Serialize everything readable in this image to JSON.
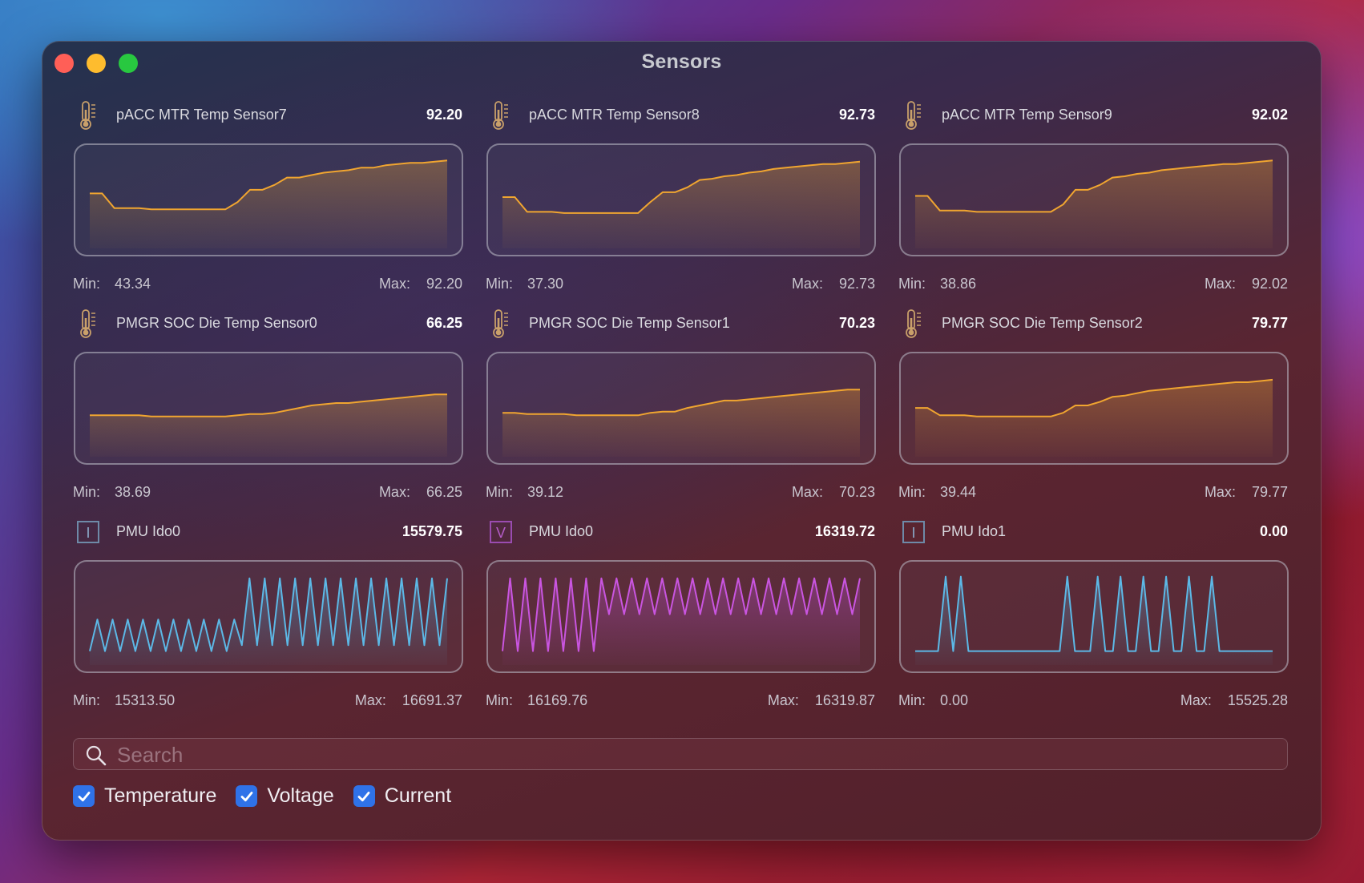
{
  "window": {
    "title": "Sensors"
  },
  "sensors": [
    {
      "icon": "thermometer-icon",
      "name": "pACC MTR Temp Sensor7",
      "value": "92.20",
      "min": "43.34",
      "max": "92.20",
      "color": "#f0a530",
      "series": [
        57,
        57,
        45,
        45,
        45,
        44,
        44,
        44,
        44,
        44,
        44,
        44,
        50,
        60,
        60,
        64,
        70,
        70,
        72,
        74,
        75,
        76,
        78,
        78,
        80,
        81,
        82,
        82,
        83,
        84
      ]
    },
    {
      "icon": "thermometer-icon",
      "name": "pACC MTR Temp Sensor8",
      "value": "92.73",
      "min": "37.30",
      "max": "92.73",
      "color": "#f0a530",
      "series": [
        54,
        54,
        42,
        42,
        42,
        41,
        41,
        41,
        41,
        41,
        41,
        41,
        50,
        58,
        58,
        62,
        68,
        69,
        71,
        72,
        74,
        75,
        77,
        78,
        79,
        80,
        81,
        81,
        82,
        83
      ]
    },
    {
      "icon": "thermometer-icon",
      "name": "pACC MTR Temp Sensor9",
      "value": "92.02",
      "min": "38.86",
      "max": "92.02",
      "color": "#f0a530",
      "series": [
        55,
        55,
        43,
        43,
        43,
        42,
        42,
        42,
        42,
        42,
        42,
        42,
        48,
        60,
        60,
        64,
        70,
        71,
        73,
        74,
        76,
        77,
        78,
        79,
        80,
        81,
        81,
        82,
        83,
        84
      ]
    },
    {
      "icon": "thermometer-icon",
      "name": "PMGR SOC Die Temp Sensor0",
      "value": "66.25",
      "min": "38.69",
      "max": "66.25",
      "color": "#f0a530",
      "series": [
        46,
        46,
        46,
        46,
        46,
        45,
        45,
        45,
        45,
        45,
        45,
        45,
        46,
        47,
        47,
        48,
        50,
        52,
        54,
        55,
        56,
        56,
        57,
        58,
        59,
        60,
        61,
        62,
        63,
        63
      ]
    },
    {
      "icon": "thermometer-icon",
      "name": "PMGR SOC Die Temp Sensor1",
      "value": "70.23",
      "min": "39.12",
      "max": "70.23",
      "color": "#f0a530",
      "series": [
        48,
        48,
        47,
        47,
        47,
        47,
        46,
        46,
        46,
        46,
        46,
        46,
        48,
        49,
        49,
        52,
        54,
        56,
        58,
        58,
        59,
        60,
        61,
        62,
        63,
        64,
        65,
        66,
        67,
        67
      ]
    },
    {
      "icon": "thermometer-icon",
      "name": "PMGR SOC Die Temp Sensor2",
      "value": "79.77",
      "min": "39.44",
      "max": "79.77",
      "color": "#f0a530",
      "series": [
        52,
        52,
        46,
        46,
        46,
        45,
        45,
        45,
        45,
        45,
        45,
        45,
        48,
        54,
        54,
        57,
        61,
        62,
        64,
        66,
        67,
        68,
        69,
        70,
        71,
        72,
        73,
        73,
        74,
        75
      ]
    },
    {
      "icon": "current-icon",
      "name": "PMU Ido0",
      "value": "15579.75",
      "min": "15313.50",
      "max": "16691.37",
      "color": "#5cb8e6",
      "kind": "zig1"
    },
    {
      "icon": "voltage-icon",
      "name": "PMU Ido0",
      "value": "16319.72",
      "min": "16169.76",
      "max": "16319.87",
      "color": "#c955e0",
      "kind": "zig2"
    },
    {
      "icon": "current-icon",
      "name": "PMU Ido1",
      "value": "0.00",
      "min": "0.00",
      "max": "15525.28",
      "color": "#5cb8e6",
      "kind": "spikes"
    }
  ],
  "search": {
    "placeholder": "Search"
  },
  "filters": [
    {
      "label": "Temperature",
      "checked": true
    },
    {
      "label": "Voltage",
      "checked": true
    },
    {
      "label": "Current",
      "checked": true
    }
  ],
  "labels": {
    "min": "Min:",
    "max": "Max:"
  },
  "icon_letters": {
    "current": "I",
    "voltage": "V"
  }
}
